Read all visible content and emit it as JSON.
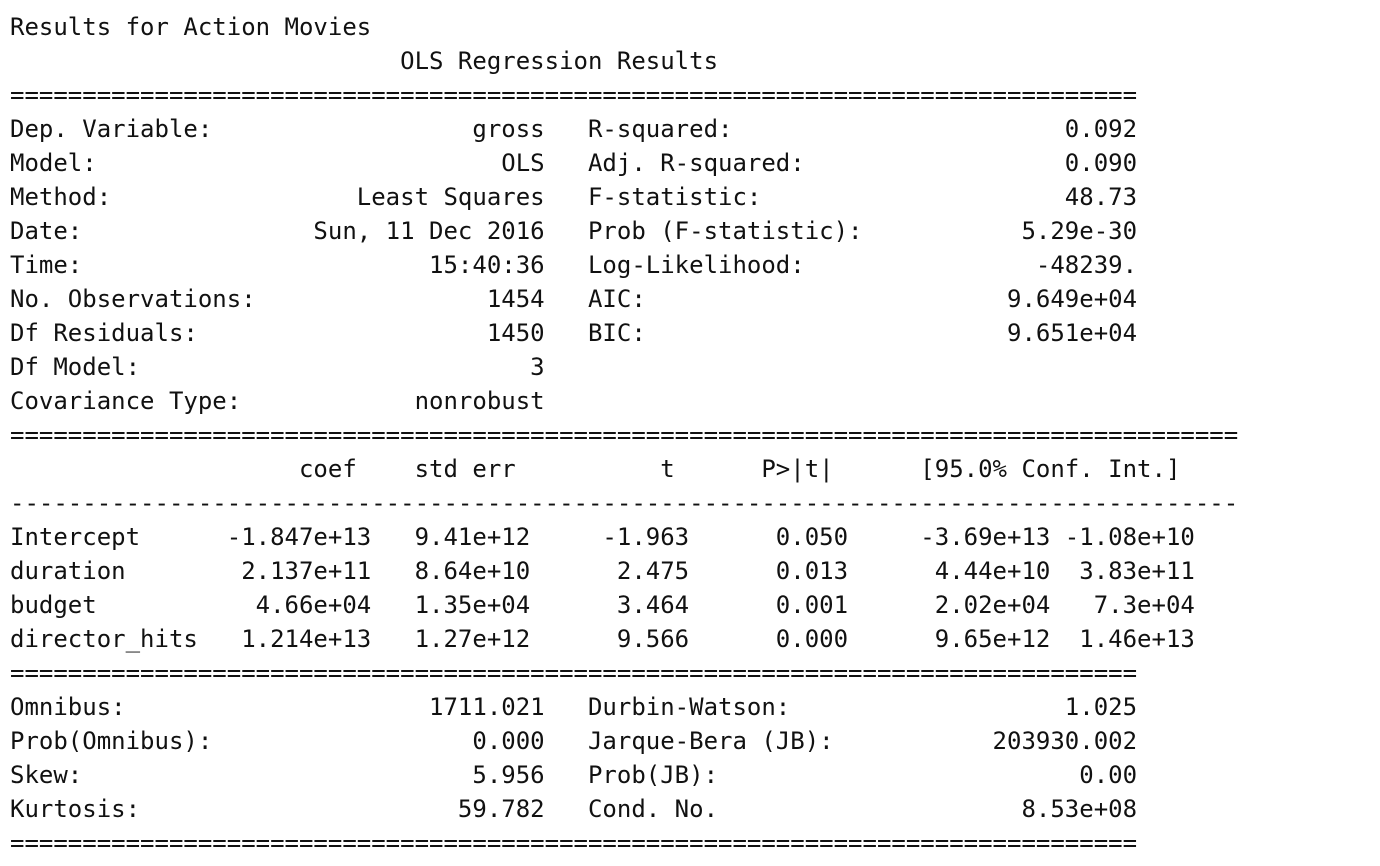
{
  "heading": "Results for Action Movies",
  "summary_lines": [
    "                           OLS Regression Results                            ",
    "==============================================================================",
    "Dep. Variable:                  gross   R-squared:                       0.092",
    "Model:                            OLS   Adj. R-squared:                  0.090",
    "Method:                 Least Squares   F-statistic:                     48.73",
    "Date:                Sun, 11 Dec 2016   Prob (F-statistic):           5.29e-30",
    "Time:                        15:40:36   Log-Likelihood:                -48239.",
    "No. Observations:                1454   AIC:                         9.649e+04",
    "Df Residuals:                    1450   BIC:                         9.651e+04",
    "Df Model:                           3                                         ",
    "Covariance Type:            nonrobust                                         ",
    "=====================================================================================",
    "                    coef    std err          t      P>|t|      [95.0% Conf. Int.]",
    "-------------------------------------------------------------------------------------",
    "Intercept      -1.847e+13   9.41e+12     -1.963      0.050     -3.69e+13 -1.08e+10",
    "duration        2.137e+11   8.64e+10      2.475      0.013      4.44e+10  3.83e+11",
    "budget           4.66e+04   1.35e+04      3.464      0.001      2.02e+04   7.3e+04",
    "director_hits   1.214e+13   1.27e+12      9.566      0.000      9.65e+12  1.46e+13",
    "==============================================================================",
    "Omnibus:                     1711.021   Durbin-Watson:                   1.025",
    "Prob(Omnibus):                  0.000   Jarque-Bera (JB):           203930.002",
    "Skew:                           5.956   Prob(JB):                         0.00",
    "Kurtosis:                      59.782   Cond. No.                     8.53e+08",
    "=============================================================================="
  ]
}
